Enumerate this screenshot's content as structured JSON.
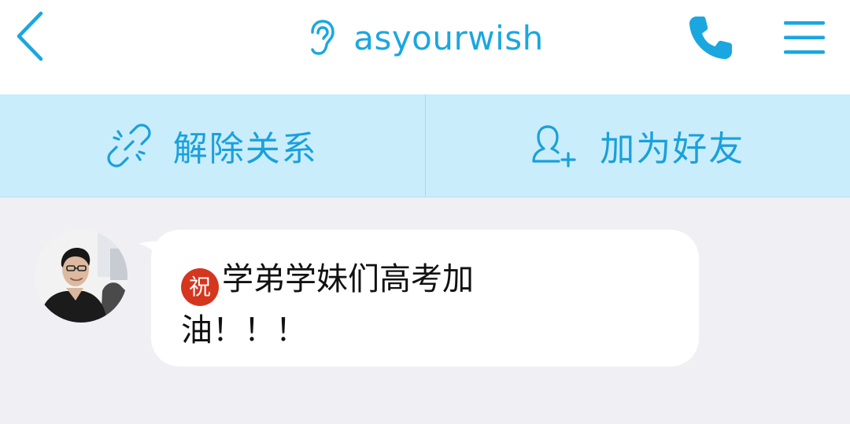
{
  "header": {
    "title": "asyourwish",
    "back_icon": "chevron-left-icon",
    "status_icon": "ear-icon",
    "call_icon": "phone-icon",
    "menu_icon": "hamburger-menu-icon",
    "accent_color": "#1aa7e0"
  },
  "actions": [
    {
      "label": "解除关系",
      "icon": "broken-link-icon"
    },
    {
      "label": "加为好友",
      "icon": "add-friend-icon"
    }
  ],
  "colors": {
    "action_bar_bg": "#c9edfb",
    "chat_bg": "#efeff4",
    "bubble_bg": "#ffffff"
  },
  "messages": [
    {
      "sender": "asyourwish",
      "emoji_badge": "祝",
      "text": "学弟学妹们高考加油！！！"
    }
  ]
}
